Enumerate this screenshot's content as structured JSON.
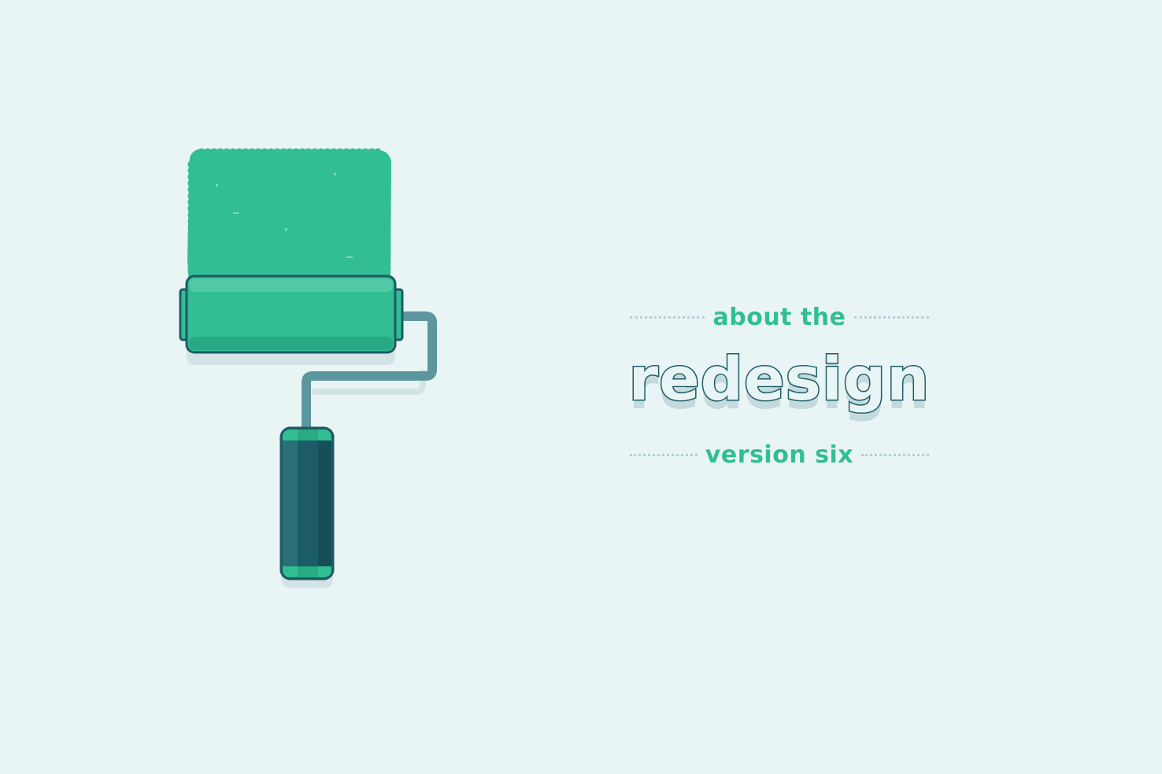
{
  "headline": {
    "top_label": "about the",
    "main_word": "redesign",
    "bottom_label": "version six"
  },
  "colors": {
    "background": "#e9f4f4",
    "accent_green": "#31be93",
    "dark_teal": "#1c5c67",
    "handle_teal": "#5c97a0",
    "shadow": "#d4e4e6",
    "dotted_line": "#b4cfd2"
  },
  "icons": [
    "paint-roller-icon",
    "paint-swatch"
  ]
}
